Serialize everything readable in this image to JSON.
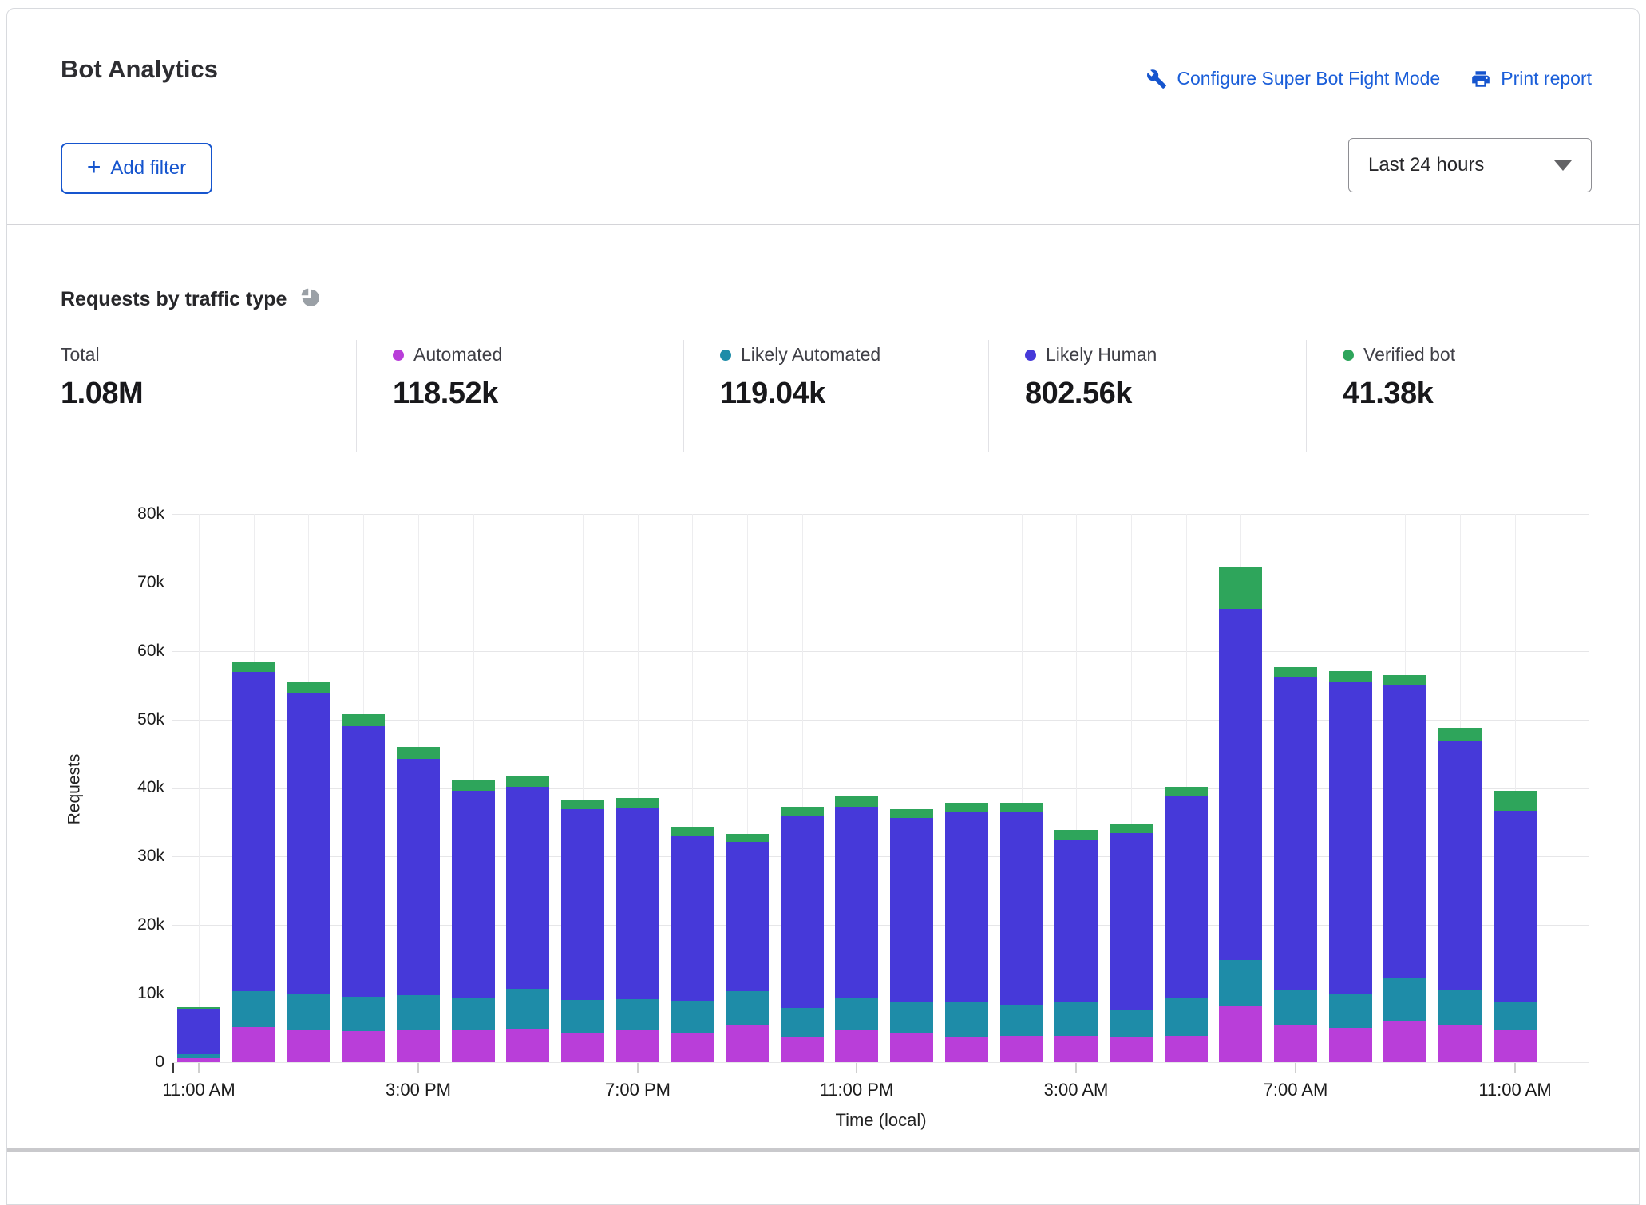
{
  "header": {
    "title": "Bot Analytics",
    "configure_link": "Configure Super Bot Fight Mode",
    "print_link": "Print report",
    "add_filter_label": "Add filter",
    "add_filter_plus": "+",
    "time_range": "Last 24 hours"
  },
  "section": {
    "title": "Requests by traffic type"
  },
  "stats": {
    "total": {
      "label": "Total",
      "value": "1.08M"
    },
    "automated": {
      "label": "Automated",
      "value": "118.52k",
      "color": "#b93ed9"
    },
    "likely_automated": {
      "label": "Likely Automated",
      "value": "119.04k",
      "color": "#1e8ca8"
    },
    "likely_human": {
      "label": "Likely Human",
      "value": "802.56k",
      "color": "#4639d9"
    },
    "verified_bot": {
      "label": "Verified bot",
      "value": "41.38k",
      "color": "#2ea55b"
    }
  },
  "chart_data": {
    "type": "bar",
    "stacked": true,
    "title": "Requests by traffic type",
    "xlabel": "Time (local)",
    "ylabel": "Requests",
    "ylim": [
      0,
      80000
    ],
    "grid": true,
    "y_tick_labels": [
      "0",
      "10k",
      "20k",
      "30k",
      "40k",
      "50k",
      "60k",
      "70k",
      "80k"
    ],
    "x_tick_labels": [
      "11:00 AM",
      "3:00 PM",
      "7:00 PM",
      "11:00 PM",
      "3:00 AM",
      "7:00 AM",
      "11:00 AM"
    ],
    "x": [
      "11:00 AM",
      "12:00 PM",
      "1:00 PM",
      "2:00 PM",
      "3:00 PM",
      "4:00 PM",
      "5:00 PM",
      "6:00 PM",
      "7:00 PM",
      "8:00 PM",
      "9:00 PM",
      "10:00 PM",
      "11:00 PM",
      "12:00 AM",
      "1:00 AM",
      "2:00 AM",
      "3:00 AM",
      "4:00 AM",
      "5:00 AM",
      "6:00 AM",
      "7:00 AM",
      "8:00 AM",
      "9:00 AM",
      "10:00 AM",
      "11:00 AM"
    ],
    "series": [
      {
        "name": "Automated",
        "color": "#b93ed9",
        "values": [
          600,
          5100,
          4600,
          4500,
          4700,
          4600,
          4900,
          4200,
          4600,
          4300,
          5300,
          3600,
          4700,
          4200,
          3700,
          3900,
          3800,
          3600,
          3800,
          8100,
          5300,
          5000,
          6000,
          5500,
          4700
        ]
      },
      {
        "name": "Likely Automated",
        "color": "#1e8ca8",
        "values": [
          600,
          5300,
          5300,
          5100,
          5100,
          4700,
          5800,
          4900,
          4600,
          4700,
          5100,
          4300,
          4700,
          4500,
          5200,
          4500,
          5100,
          4000,
          5500,
          6800,
          5300,
          5000,
          6400,
          5000,
          4100
        ]
      },
      {
        "name": "Likely Human",
        "color": "#4639d9",
        "values": [
          6500,
          46500,
          44000,
          39400,
          34400,
          30300,
          29500,
          27800,
          27900,
          23900,
          21700,
          28100,
          27900,
          26900,
          27500,
          28100,
          23500,
          25800,
          29600,
          51200,
          45600,
          45600,
          42700,
          36300,
          27900
        ]
      },
      {
        "name": "Verified bot",
        "color": "#2ea55b",
        "values": [
          300,
          1500,
          1700,
          1800,
          1800,
          1500,
          1500,
          1400,
          1400,
          1400,
          1200,
          1300,
          1500,
          1300,
          1400,
          1300,
          1500,
          1300,
          1300,
          6200,
          1500,
          1500,
          1400,
          2000,
          2900
        ]
      }
    ]
  }
}
